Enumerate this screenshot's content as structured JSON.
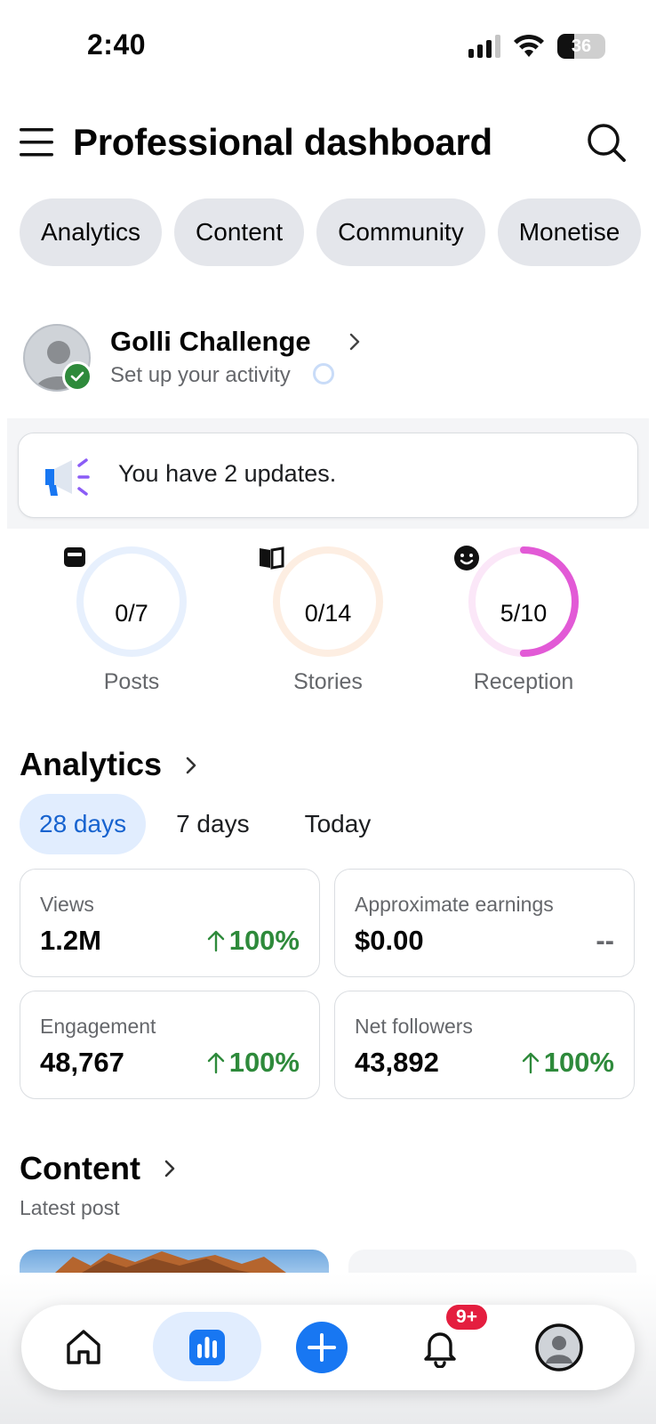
{
  "status_bar": {
    "time": "2:40",
    "battery": "36",
    "battery_level": 0.36
  },
  "header": {
    "title": "Professional dashboard",
    "menu_icon": "hamburger-menu-icon",
    "search_icon": "search-icon"
  },
  "chips": [
    "Analytics",
    "Content",
    "Community",
    "Monetise"
  ],
  "profile": {
    "name": "Golli Challenge",
    "subtitle": "Set up your activity"
  },
  "updates": {
    "text": "You have 2 updates.",
    "icon": "megaphone-icon"
  },
  "goals": [
    {
      "label": "Posts",
      "value": "0/7",
      "progress": 0.0,
      "color": "#e7f0fd",
      "accent": "#1877f2",
      "icon": "post-icon"
    },
    {
      "label": "Stories",
      "value": "0/14",
      "progress": 0.0,
      "color": "#fdeee2",
      "accent": "#f28b3c",
      "icon": "book-icon"
    },
    {
      "label": "Reception",
      "value": "5/10",
      "progress": 0.5,
      "color": "#fbe7f8",
      "accent": "#e25ad6",
      "icon": "smiley-icon"
    }
  ],
  "analytics": {
    "title": "Analytics",
    "tabs": [
      "28 days",
      "7 days",
      "Today"
    ],
    "active_tab": "28 days",
    "metrics": [
      {
        "label": "Views",
        "value": "1.2M",
        "change": "100%",
        "trend": "up"
      },
      {
        "label": "Approximate earnings",
        "value": "$0.00",
        "change": "--",
        "trend": "none"
      },
      {
        "label": "Engagement",
        "value": "48,767",
        "change": "100%",
        "trend": "up"
      },
      {
        "label": "Net followers",
        "value": "43,892",
        "change": "100%",
        "trend": "up"
      }
    ]
  },
  "content": {
    "title": "Content",
    "subtitle": "Latest post"
  },
  "bottom_nav": {
    "items": [
      "home-icon",
      "professional-dashboard-icon",
      "create-icon",
      "notifications-icon",
      "profile-icon"
    ],
    "active": "professional-dashboard-icon",
    "notification_badge": "9+"
  },
  "colors": {
    "accent_blue": "#1877f2",
    "positive_green": "#2e8a3b",
    "badge_red": "#e41e3f"
  }
}
